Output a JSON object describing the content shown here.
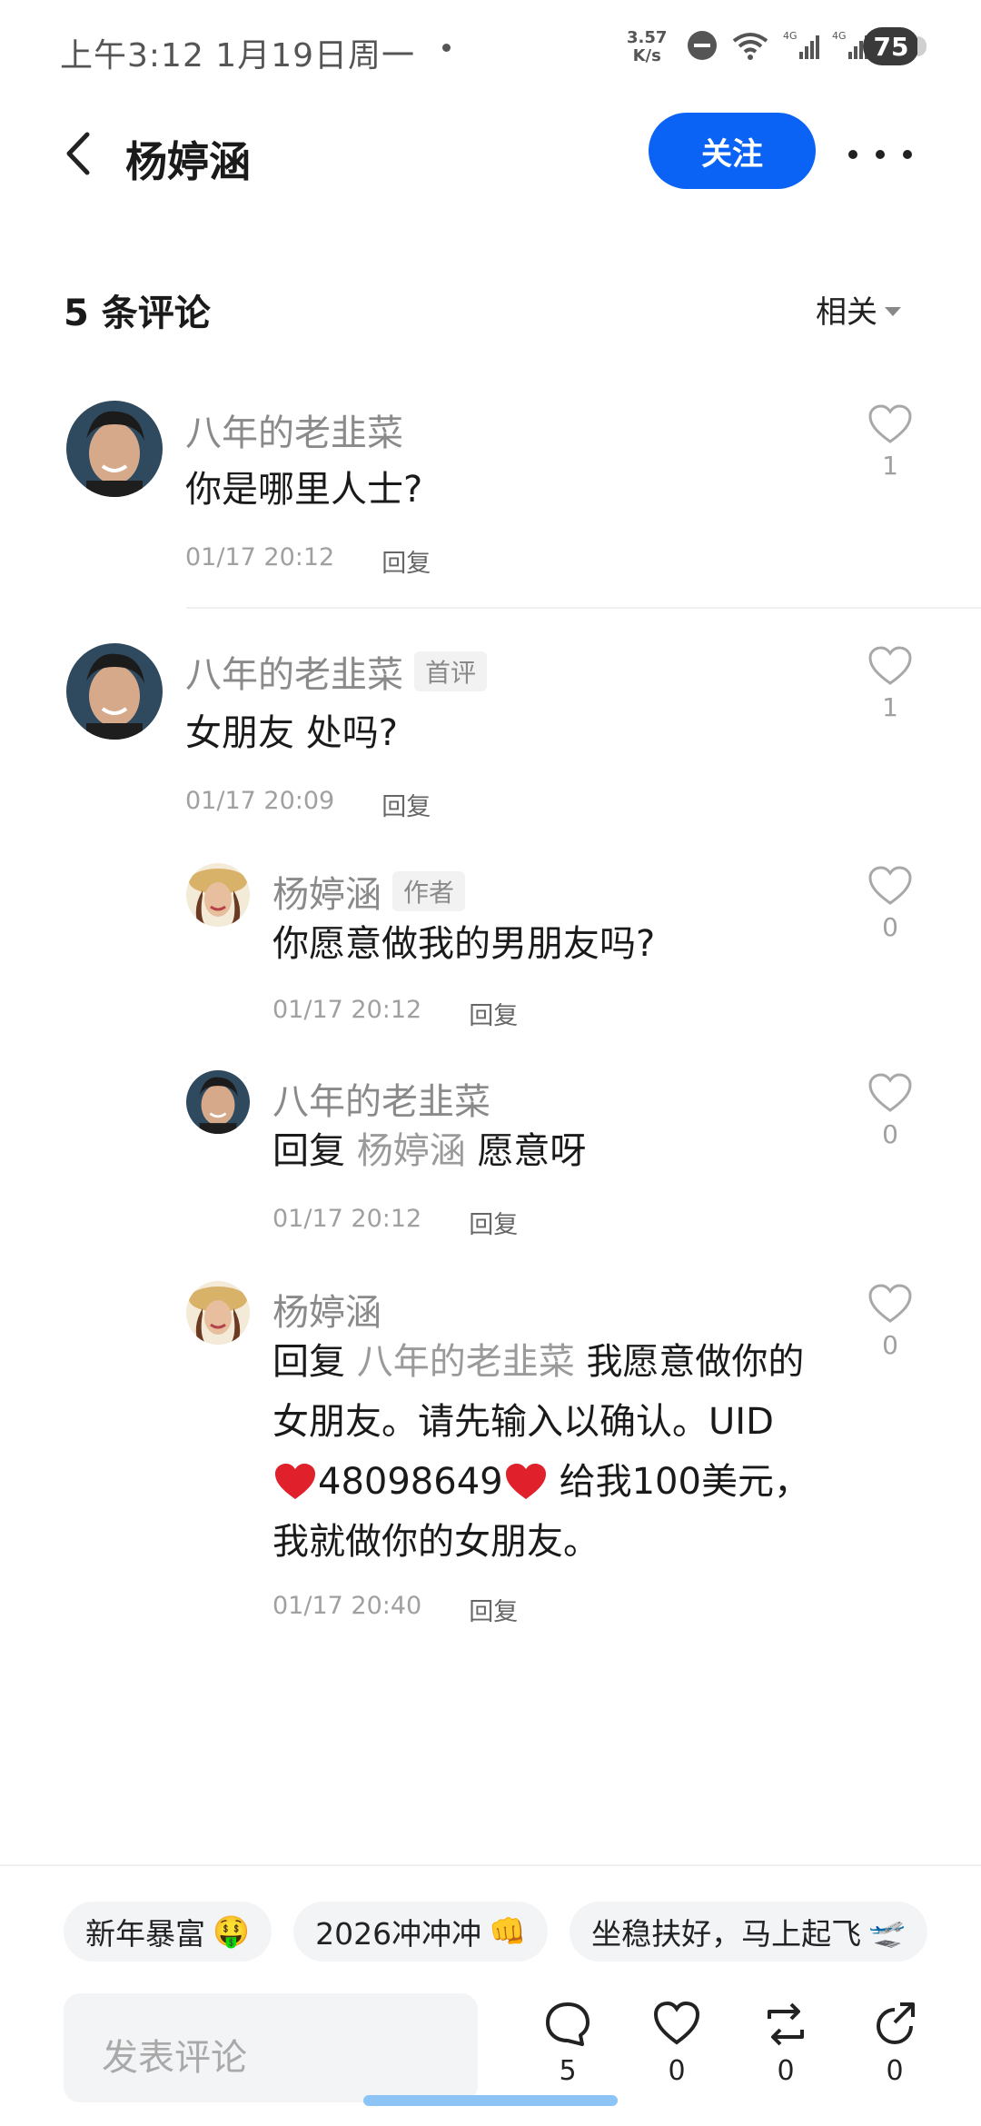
{
  "status_bar": {
    "time": "上午3:12  1月19日周一",
    "speed_value": "3.57",
    "speed_unit": "K/s",
    "battery": "75"
  },
  "header": {
    "title": "杨婷涵",
    "follow_label": "关注"
  },
  "comments_header": {
    "count_label": "5 条评论",
    "sort_label": "相关"
  },
  "comments": [
    {
      "author": "八年的老韭菜",
      "text": "你是哪里人士?",
      "time": "01/17 20:12",
      "reply_label": "回复",
      "likes": "1"
    },
    {
      "author": "八年的老韭菜",
      "badge": "首评",
      "text": "女朋友 处吗?",
      "time": "01/17 20:09",
      "reply_label": "回复",
      "likes": "1",
      "replies": [
        {
          "author": "杨婷涵",
          "badge": "作者",
          "text": "你愿意做我的男朋友吗?",
          "time": "01/17 20:12",
          "reply_label": "回复",
          "likes": "0"
        },
        {
          "author": "八年的老韭菜",
          "reply_prefix": "回复",
          "mention": "杨婷涵",
          "text": "愿意呀",
          "time": "01/17 20:12",
          "reply_label": "回复",
          "likes": "0"
        },
        {
          "author": "杨婷涵",
          "reply_prefix": "回复",
          "mention": "八年的老韭菜",
          "text_line1": "我愿意做你的",
          "text_line2": "女朋友。请先输入以确认。UID",
          "uid": "48098649",
          "text_line3_tail": "给我100美元，",
          "text_line4": "我就做你的女朋友。",
          "time": "01/17 20:40",
          "reply_label": "回复",
          "likes": "0"
        }
      ]
    }
  ],
  "chips": [
    {
      "label": "新年暴富",
      "emoji": "🤑"
    },
    {
      "label": "2026冲冲冲",
      "emoji": "👊"
    },
    {
      "label": "坐稳扶好，马上起飞",
      "emoji": "🛫"
    }
  ],
  "composer": {
    "placeholder": "发表评论"
  },
  "actions": {
    "comments": "5",
    "likes": "0",
    "reposts": "0",
    "shares": "0"
  },
  "colors": {
    "accent": "#0b63f6",
    "muted_text": "#8a8a8a",
    "heart_red": "#e0202a"
  }
}
